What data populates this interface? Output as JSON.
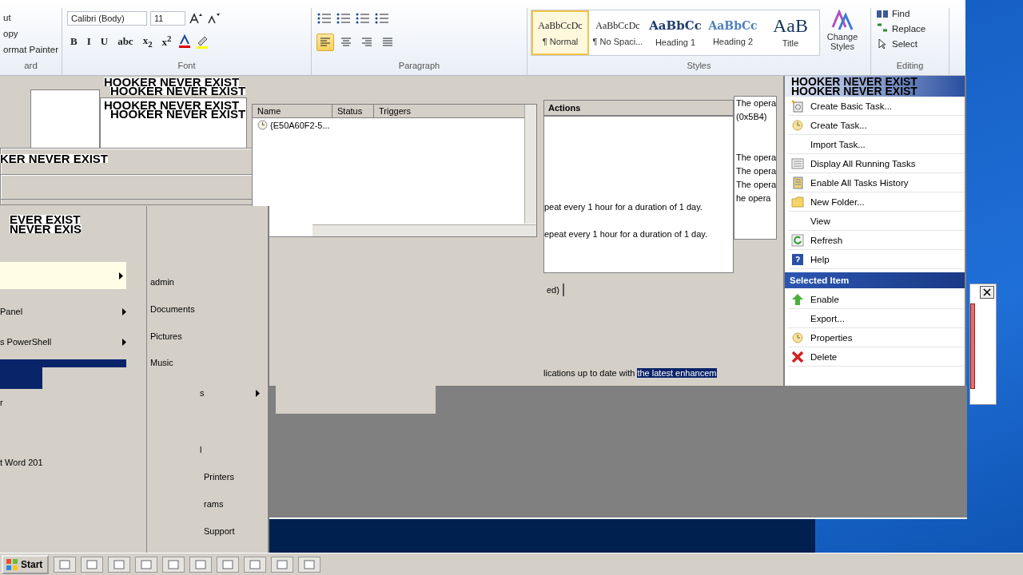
{
  "ribbon": {
    "clipboard": {
      "items": [
        "ut",
        "opy",
        "ormat Painter"
      ],
      "group_label": "ard"
    },
    "font": {
      "font_name": "Calibri (Body)",
      "font_size": "11",
      "format_buttons": [
        "B",
        "I",
        "U",
        "abc",
        "x$_{2}$",
        "x$^{2}$"
      ],
      "group_label": "Font"
    },
    "paragraph": {
      "alignments": [
        {
          "kind": "left",
          "selected": true
        },
        {
          "kind": "center",
          "selected": false
        },
        {
          "kind": "right",
          "selected": false
        },
        {
          "kind": "justify",
          "selected": false
        }
      ],
      "group_label": "Paragraph"
    },
    "styles": {
      "items": [
        {
          "preview": "AaBbCcDc",
          "label": "¶ Normal",
          "kind": "plain",
          "selected": true
        },
        {
          "preview": "AaBbCcDc",
          "label": "¶ No Spaci...",
          "kind": "plain",
          "selected": false
        },
        {
          "preview": "AaBbCc",
          "label": "Heading 1",
          "kind": "heading1",
          "selected": false
        },
        {
          "preview": "AaBbCc",
          "label": "Heading 2",
          "kind": "heading2",
          "selected": false
        },
        {
          "preview": "AaB",
          "label": "Title",
          "kind": "title",
          "selected": false
        }
      ],
      "change_styles": "Change Styles",
      "group_label": "Styles"
    },
    "editing": {
      "items": [
        {
          "kind": "find",
          "label": "Find"
        },
        {
          "kind": "replace",
          "label": "Replace"
        },
        {
          "kind": "select",
          "label": "Select"
        }
      ],
      "group_label": "Editing"
    }
  },
  "hooker_labels": [
    "HOOKER NEVER EXIST",
    "HOOKER NEVER EXIST",
    "HOOKER NEVER EXIST",
    "HOOKER NEVER EXIST",
    "KER NEVER EXIST",
    "EVER EXIST",
    "NEVER EXIS"
  ],
  "task_list": {
    "columns": [
      "Name",
      "Status",
      "Triggers"
    ],
    "rows": [
      {
        "name": "{E50A60F2-5..."
      }
    ]
  },
  "task_detail": {
    "header": "Actions",
    "trigger_lines": [
      "peat every 1 hour for a duration of 1 day.",
      "epeat every 1 hour for a duration of 1 day."
    ],
    "tab_fragment": "ed)",
    "description": "lications up to date with",
    "selected_text": "the latest enhancem"
  },
  "history_messages": [
    "The opera",
    "(0x5B4)",
    "The opera",
    "The opera",
    "The opera",
    "he opera"
  ],
  "actions_pane": {
    "title_lines": [
      "HOOKER NEVER EXIST",
      "HOOKER NEVER EXIST"
    ],
    "items": [
      {
        "label": "Create Basic Task...",
        "kind": "wizard"
      },
      {
        "label": "Create Task...",
        "kind": "task"
      },
      {
        "label": "Import Task...",
        "kind": "none"
      },
      {
        "label": "Display All Running Tasks",
        "kind": "list"
      },
      {
        "label": "Enable All Tasks History",
        "kind": "book"
      },
      {
        "label": "New Folder...",
        "kind": "folder"
      },
      {
        "label": "View",
        "kind": "none"
      },
      {
        "label": "Refresh",
        "kind": "refresh"
      },
      {
        "label": "Help",
        "kind": "help"
      }
    ],
    "section": "Selected Item",
    "selected_items": [
      {
        "label": "Enable",
        "kind": "enable"
      },
      {
        "label": "Export...",
        "kind": "none"
      },
      {
        "label": "Properties",
        "kind": "task"
      },
      {
        "label": "Delete",
        "kind": "delete"
      }
    ]
  },
  "start_menu": {
    "left_items": [
      {
        "label": "Panel",
        "submenu": true
      },
      {
        "label": "s PowerShell",
        "submenu": true
      },
      {
        "label": "r",
        "submenu": false
      },
      {
        "label": "t Word 201",
        "submenu": false
      }
    ],
    "right_items": [
      {
        "label": "admin",
        "submenu": false
      },
      {
        "label": "Documents",
        "submenu": false
      },
      {
        "label": "Pictures",
        "submenu": false
      },
      {
        "label": "Music",
        "submenu": false
      },
      {
        "label": "s",
        "submenu": true
      },
      {
        "label": "l",
        "submenu": false
      },
      {
        "label": "Printers",
        "submenu": false
      },
      {
        "label": "rams",
        "submenu": false
      },
      {
        "label": "Support",
        "submenu": false
      }
    ]
  },
  "taskbar": {
    "start_label": "Start"
  }
}
